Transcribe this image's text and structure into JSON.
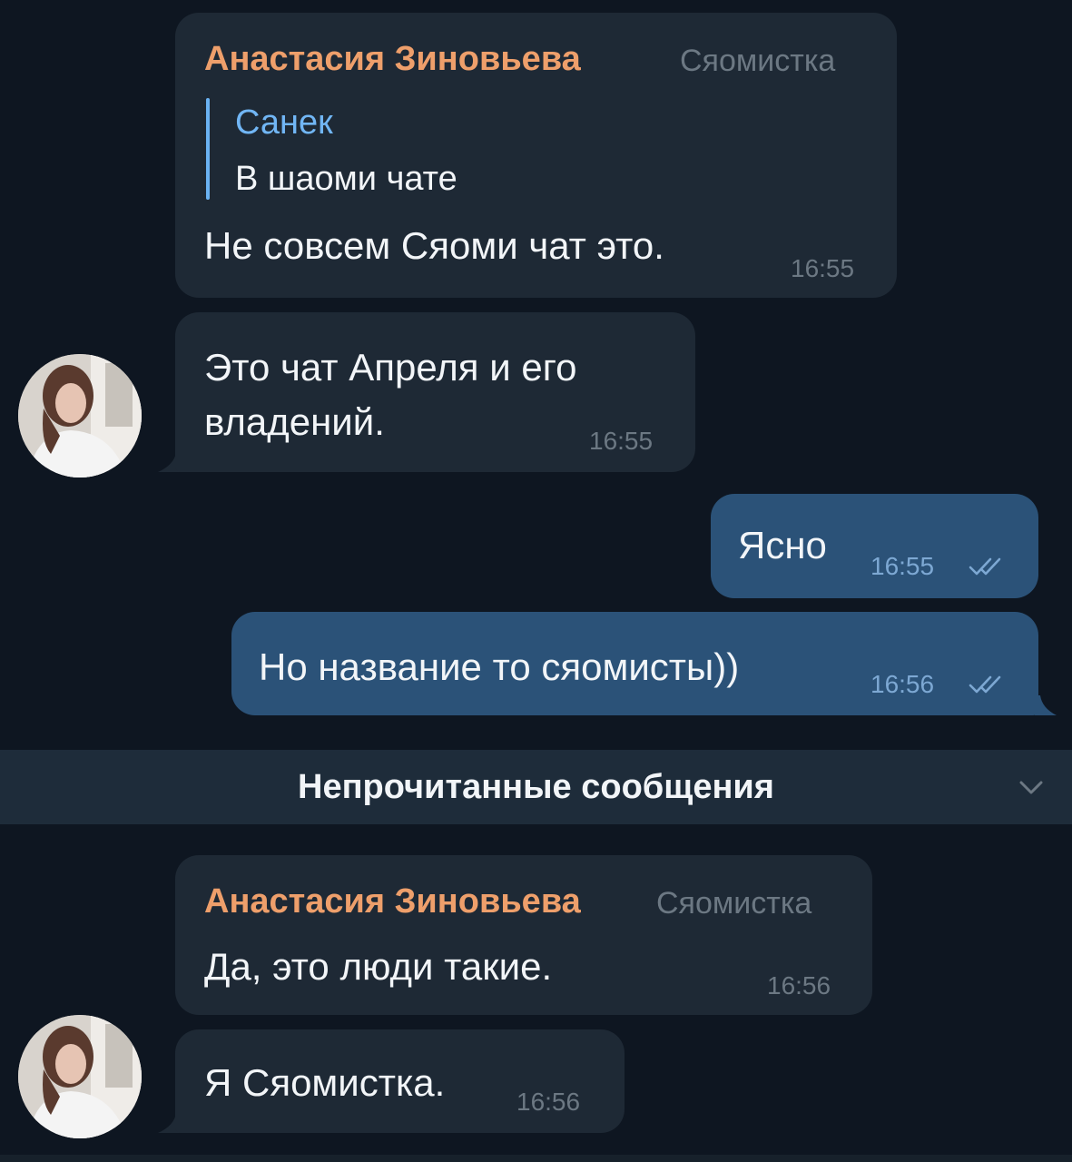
{
  "messages": [
    {
      "sender": "Анастасия Зиновьева",
      "role": "Сяомистка",
      "reply": {
        "name": "Санек",
        "text": "В шаоми чате"
      },
      "text": "Не совсем Сяоми чат это.",
      "time": "16:55"
    },
    {
      "text_line1": "Это чат Апреля и его",
      "text_line2": "владений.",
      "time": "16:55"
    },
    {
      "text": "Ясно",
      "time": "16:55"
    },
    {
      "text": "Но название то сяомисты))",
      "time": "16:56"
    },
    {
      "sender": "Анастасия Зиновьева",
      "role": "Сяомистка",
      "text": "Да, это люди такие.",
      "time": "16:56"
    },
    {
      "text": "Я Сяомистка.",
      "time": "16:56"
    }
  ],
  "unread": {
    "label": "Непрочитанные сообщения"
  },
  "colors": {
    "background": "#0e1621",
    "incoming_bubble": "#1e2935",
    "outgoing_bubble": "#2b5278",
    "sender_name": "#ee9f6b",
    "reply_accent": "#6ab2f2"
  }
}
